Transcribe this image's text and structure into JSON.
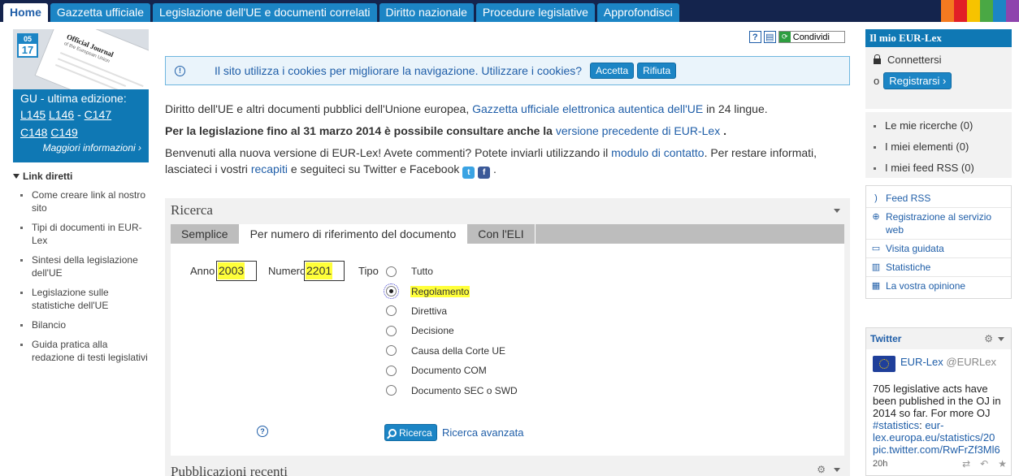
{
  "nav": {
    "tabs": [
      {
        "label": "Home",
        "active": true
      },
      {
        "label": "Gazzetta ufficiale"
      },
      {
        "label": "Legislazione dell'UE e documenti correlati"
      },
      {
        "label": "Diritto nazionale"
      },
      {
        "label": "Procedure legislative"
      },
      {
        "label": "Approfondisci"
      }
    ],
    "stripe_colors": [
      "#f47a20",
      "#e21f26",
      "#f7c300",
      "#4aa844",
      "#1c85c5",
      "#8e44ad"
    ]
  },
  "gu": {
    "month": "05",
    "day": "17",
    "cover_title": "Official Journal",
    "cover_subtitle": "of the European Union",
    "title": "GU - ultima edizione:",
    "links": [
      "L145",
      "L146",
      "C147",
      "C148",
      "C149"
    ],
    "more": "Maggiori informazioni"
  },
  "direct_links": {
    "title": "Link diretti",
    "items": [
      "Come creare link al nostro sito",
      "Tipi di documenti in EUR-Lex",
      "Sintesi della legislazione dell'UE",
      "Legislazione sulle statistiche dell'UE",
      "Bilancio",
      "Guida pratica alla redazione di testi legislativi"
    ]
  },
  "toolbar": {
    "help": "?",
    "share": "Condividi"
  },
  "cookie": {
    "message": "Il sito utilizza i cookies per migliorare la navigazione. Utilizzare i cookies?",
    "accept": "Accetta",
    "refuse": "Rifiuta"
  },
  "intro": {
    "p1_text": "Diritto dell'UE e altri documenti pubblici dell'Unione europea,",
    "p1_link": "Gazzetta ufficiale elettronica autentica dell'UE",
    "p1_end": "in 24 lingue.",
    "p2_text": "Per la legislazione fino al 31 marzo 2014 è possibile consultare anche la",
    "p2_link": "versione precedente di EUR-Lex",
    "p2_end": ".",
    "p3_text": "Benvenuti alla nuova versione di EUR-Lex! Avete commenti? Potete inviarli utilizzando il",
    "p3_link1": "modulo di contatto",
    "p3_mid": ". Per restare informati, lasciateci i vostri",
    "p3_link2": "recapiti",
    "p3_end": "e seguiteci su Twitter e Facebook",
    "p3_final": "."
  },
  "search": {
    "title": "Ricerca",
    "tabs": [
      {
        "label": "Semplice"
      },
      {
        "label": "Per numero di riferimento del documento",
        "active": true
      },
      {
        "label": "Con l'ELI"
      }
    ],
    "year_label": "Anno",
    "year_value": "2003",
    "number_label": "Numero",
    "number_value": "2201",
    "type_label": "Tipo",
    "types": [
      {
        "label": "Tutto"
      },
      {
        "label": "Regolamento",
        "selected": true
      },
      {
        "label": "Direttiva"
      },
      {
        "label": "Decisione"
      },
      {
        "label": "Causa della Corte UE"
      },
      {
        "label": "Documento COM"
      },
      {
        "label": "Documento SEC o SWD"
      }
    ],
    "help": "?",
    "button": "Ricerca",
    "advanced": "Ricerca avanzata"
  },
  "recent": {
    "title": "Pubblicazioni recenti"
  },
  "my_eurlex": {
    "title": "Il mio EUR-Lex",
    "login": "Connettersi",
    "or": "o",
    "register": "Registrarsi",
    "items": [
      "Le mie ricerche (0)",
      "I miei elementi (0)",
      "I miei feed RSS (0)"
    ]
  },
  "services": [
    {
      "icon": "rss-icon",
      "label": "Feed RSS"
    },
    {
      "icon": "web-service-icon",
      "label": "Registrazione al servizio web"
    },
    {
      "icon": "monitor-icon",
      "label": "Visita guidata"
    },
    {
      "icon": "bar-chart-icon",
      "label": "Statistiche"
    },
    {
      "icon": "feedback-icon",
      "label": "La vostra opinione"
    }
  ],
  "twitter": {
    "title": "Twitter",
    "name": "EUR-Lex",
    "handle": "@EURLex",
    "text1": "705 legislative acts have been published in the OJ in 2014 so far. For more OJ ",
    "hashtag": "#statistics",
    "text2": ": ",
    "link1": "eur-lex.europa.eu/statistics/20",
    "link2": "pic.twitter.com/RwFrZf3Ml6",
    "time": "20h"
  }
}
